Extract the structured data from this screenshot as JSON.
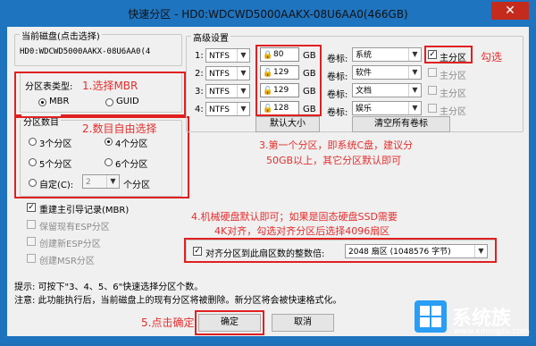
{
  "window": {
    "title": "快速分区 - HD0:WDCWD5000AAKX-08U6AA0(466GB)",
    "close": "✕"
  },
  "disk": {
    "label": "当前磁盘(点击选择)",
    "value": "HD0:WDCWD5000AAKX-08U6AA0(4"
  },
  "partition_type": {
    "label": "分区表类型:",
    "options": [
      "MBR",
      "GUID"
    ],
    "selected": "MBR"
  },
  "partition_count": {
    "label": "分区数目",
    "options": [
      "3个分区",
      "4个分区",
      "5个分区",
      "6个分区"
    ],
    "selected": "4个分区",
    "custom_label": "自定(C):",
    "custom_value": "2",
    "custom_suffix": "个分区"
  },
  "options": [
    {
      "label": "重建主引导记录(MBR)",
      "checked": true,
      "enabled": true
    },
    {
      "label": "保留现有ESP分区",
      "checked": false,
      "enabled": false
    },
    {
      "label": "创建新ESP分区",
      "checked": false,
      "enabled": false
    },
    {
      "label": "创建MSR分区",
      "checked": false,
      "enabled": false
    }
  ],
  "advanced": {
    "label": "高级设置",
    "vol_label_text": "卷标:",
    "size_unit": "GB",
    "primary_label": "主分区",
    "rows": [
      {
        "index": "1:",
        "fs": "NTFS",
        "size": "80",
        "vol": "系统",
        "primary": true,
        "enabled": true
      },
      {
        "index": "2:",
        "fs": "NTFS",
        "size": "129",
        "vol": "软件",
        "primary": false,
        "enabled": false
      },
      {
        "index": "3:",
        "fs": "NTFS",
        "size": "129",
        "vol": "文档",
        "primary": false,
        "enabled": false
      },
      {
        "index": "4:",
        "fs": "NTFS",
        "size": "128",
        "vol": "娱乐",
        "primary": false,
        "enabled": false
      }
    ],
    "default_size_button": "默认大小",
    "clear_labels_button": "清空所有卷标"
  },
  "align": {
    "label": "对齐分区到此扇区数的整数倍:",
    "checked": true,
    "value": "2048 扇区 (1048576 字节)"
  },
  "hints": [
    "提示: 可按下\"3、4、5、6\"快速选择分区个数。",
    "注意: 此功能执行后，当前磁盘上的现有分区将被删除。新分区将会被快速格式化。"
  ],
  "buttons": {
    "ok": "确定",
    "cancel": "取消"
  },
  "annotations": {
    "a1": "1.选择MBR",
    "a2": "2.数目自由选择",
    "a3_line1": "3.第一个分区，即系统C盘，建议分",
    "a3_line2": "50GB以上，其它分区默认即可",
    "a4_line1": "4.机械硬盘默认即可；如果是固态硬盘SSD需要",
    "a4_line2": "4K对齐，勾选对齐分区后选择4096扇区",
    "a5": "5.点击确定",
    "check": "勾选"
  },
  "watermark": {
    "brand": "系统族",
    "url": "www.xitongzu.com"
  },
  "colors": {
    "annotation": "#e52e2e",
    "titlebar": "#1f74bf",
    "close": "#c42b1c"
  }
}
